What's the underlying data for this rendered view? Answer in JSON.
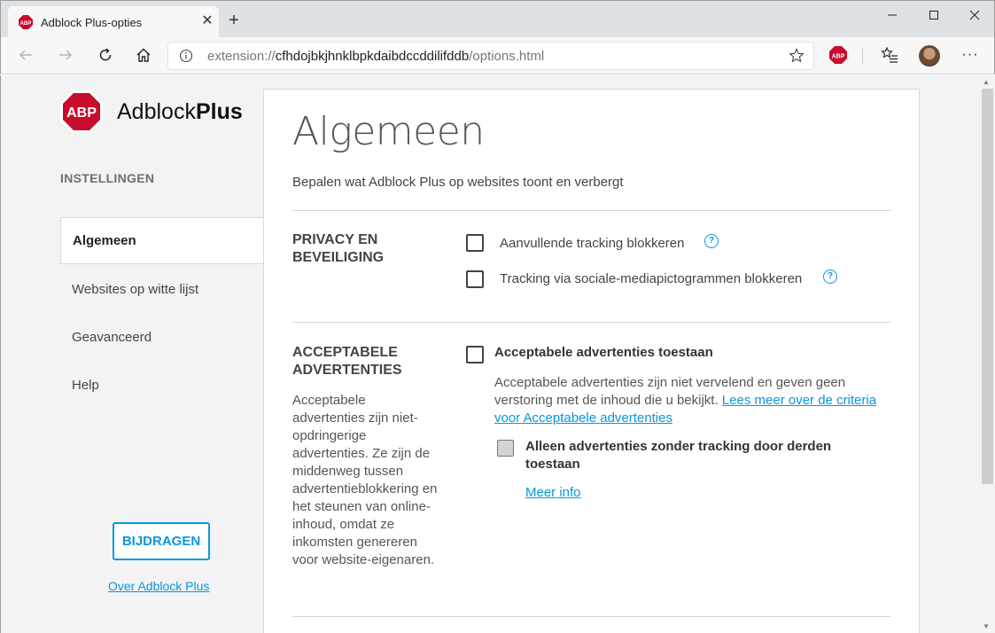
{
  "browser": {
    "tab_title": "Adblock Plus-opties",
    "tab_close": "✕",
    "new_tab": "+",
    "url_prefix": "extension://",
    "url_domain": "cfhdojbkjhnklbpkdaibdccddilifddb",
    "url_path": "/options.html",
    "extension_badge": "ABP",
    "more_menu": "···"
  },
  "sidebar": {
    "logo_text": "ABP",
    "brand_light": "Adblock",
    "brand_bold": "Plus",
    "heading": "INSTELLINGEN",
    "items": [
      {
        "label": "Algemeen"
      },
      {
        "label": "Websites op witte lijst"
      },
      {
        "label": "Geavanceerd"
      },
      {
        "label": "Help"
      }
    ],
    "contribute_label": "BIJDRAGEN",
    "about_link": "Over Adblock Plus"
  },
  "main": {
    "title": "Algemeen",
    "subtitle": "Bepalen wat Adblock Plus op websites toont en verbergt",
    "privacy": {
      "title": "PRIVACY EN BEVEILIGING",
      "options": [
        {
          "label": "Aanvullende tracking blokkeren",
          "checked": false
        },
        {
          "label": "Tracking via sociale-mediapictogrammen blokkeren",
          "checked": false
        }
      ],
      "help_glyph": "?"
    },
    "acceptable_ads": {
      "title": "ACCEPTABELE ADVERTENTIES",
      "description": "Acceptabele advertenties zijn niet-opdringerige advertenties. Ze zijn de middenweg tussen advertentieblokkering en het steunen van online-inhoud, omdat ze inkomsten genereren voor website-eigenaren.",
      "option_label": "Acceptabele advertenties toestaan",
      "option_checked": false,
      "option_desc": "Acceptabele advertenties zijn niet vervelend en geven geen verstoring met de inhoud die u bekijkt.",
      "option_link": "Lees meer over de criteria voor Acceptabele advertenties",
      "sub_option_label": "Alleen advertenties zonder tracking door derden toestaan",
      "sub_option_disabled": true,
      "more_info": "Meer info"
    }
  },
  "colors": {
    "accent": "#0797e1",
    "abp_red": "#c70d2c",
    "page_bg": "#f3f3f3"
  }
}
